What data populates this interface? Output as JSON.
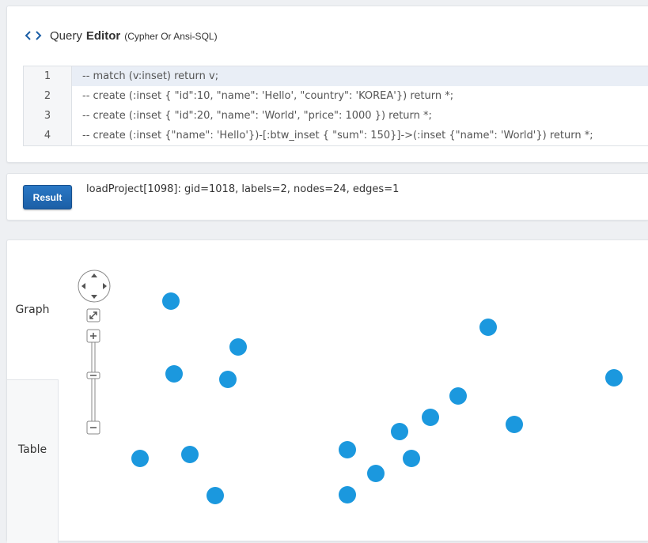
{
  "editor": {
    "title_query": "Query",
    "title_editor": "Editor",
    "title_sub": "(Cypher Or Ansi-SQL)",
    "lines": [
      {
        "no": "1",
        "text": "-- match (v:inset) return v;"
      },
      {
        "no": "2",
        "text": "-- create (:inset { \"id\":10, \"name\": 'Hello', \"country\": 'KOREA'}) return *;"
      },
      {
        "no": "3",
        "text": "-- create (:inset { \"id\":20, \"name\": 'World', \"price\": 1000 }) return *;"
      },
      {
        "no": "4",
        "text": "-- create (:inset {\"name\": 'Hello'})-[:btw_inset { \"sum\": 150}]->(:inset {\"name\": 'World'}) return *;"
      }
    ]
  },
  "result": {
    "button_label": "Result",
    "message": "loadProject[1098]: gid=1018, labels=2, nodes=24, edges=1"
  },
  "graph": {
    "tab_graph": "Graph",
    "tab_table": "Table",
    "node_color": "#1b98de",
    "node_count_visible": 18
  },
  "icons": {
    "editor": "code-brackets-icon",
    "pan": "pan-arrows-icon",
    "fit": "fit-to-screen-icon",
    "zoom_in": "zoom-in-icon",
    "zoom_out": "zoom-out-icon"
  }
}
